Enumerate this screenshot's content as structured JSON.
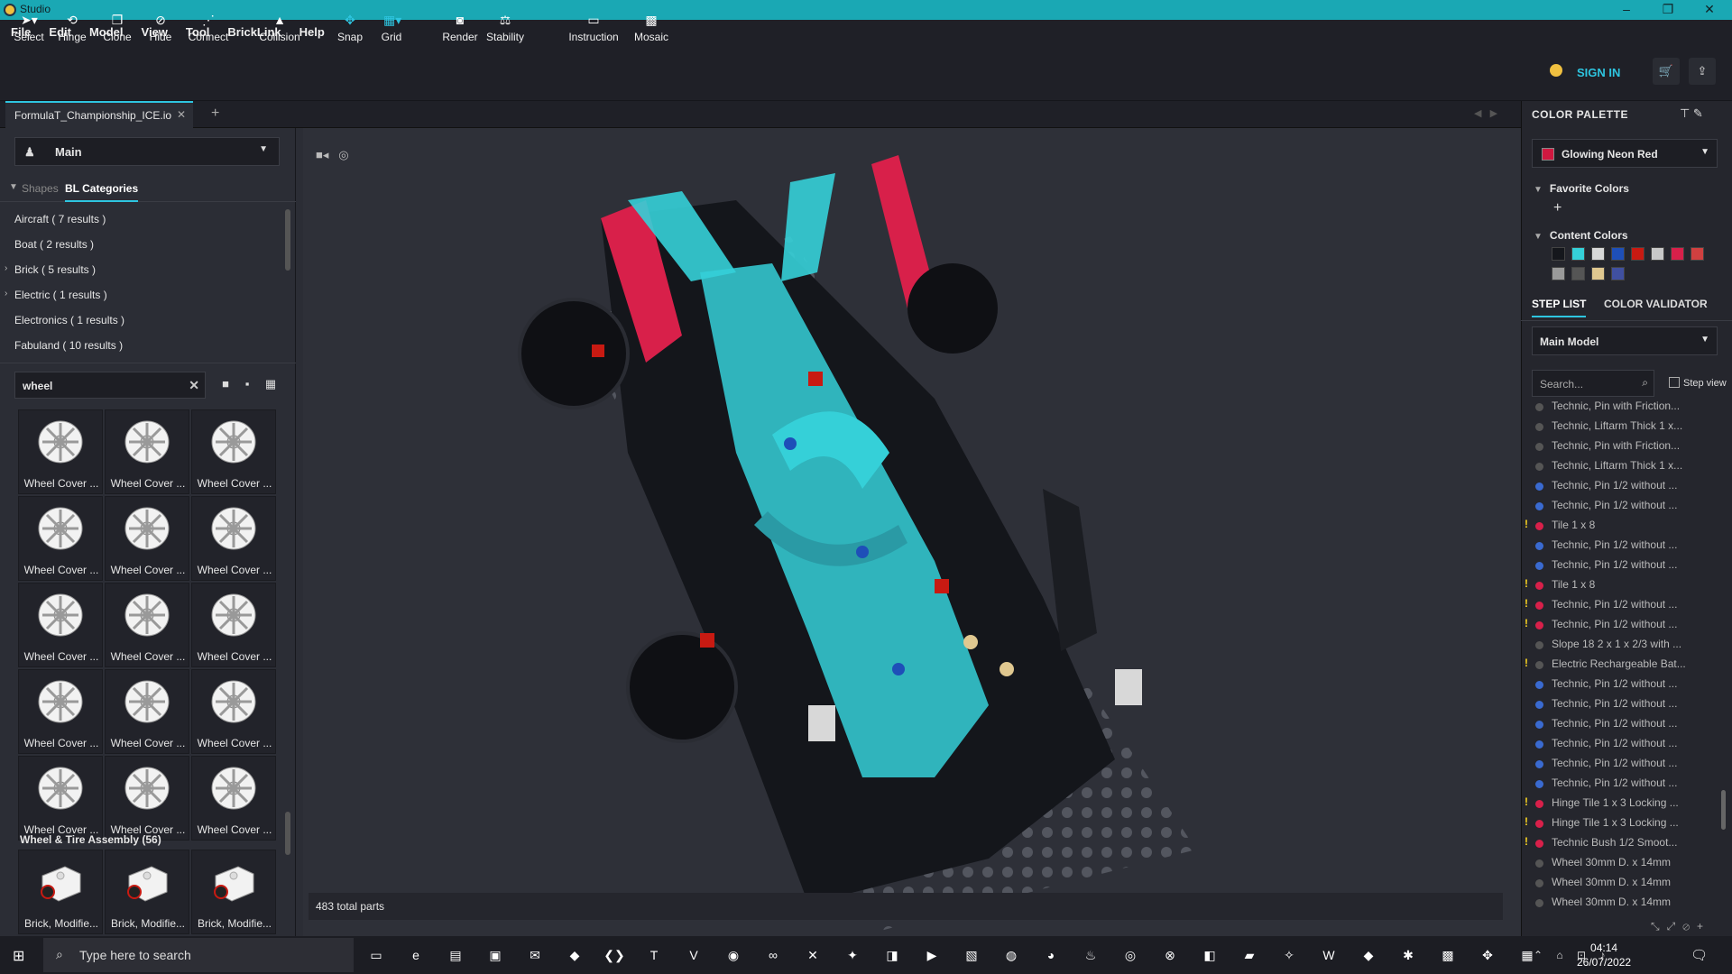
{
  "window": {
    "title": "Studio"
  },
  "menu": [
    "File",
    "Edit",
    "Model",
    "View",
    "Tool",
    "BrickLink",
    "Help"
  ],
  "toolbar": {
    "tools": [
      {
        "label": "Select",
        "icon": "cursor-icon"
      },
      {
        "label": "Hinge",
        "icon": "hinge-icon"
      },
      {
        "label": "Clone",
        "icon": "clone-icon"
      },
      {
        "label": "Hide",
        "icon": "hide-icon"
      },
      {
        "label": "Connect",
        "icon": "connect-icon"
      },
      {
        "label": "Collision",
        "icon": "collision-icon"
      },
      {
        "label": "Snap",
        "icon": "snap-icon"
      },
      {
        "label": "Grid",
        "icon": "grid-icon"
      },
      {
        "label": "Render",
        "icon": "camera-icon"
      },
      {
        "label": "Stability",
        "icon": "stability-icon"
      },
      {
        "label": "Instruction",
        "icon": "instruction-icon"
      },
      {
        "label": "Mosaic",
        "icon": "mosaic-icon"
      }
    ],
    "sign_in": "SIGN IN"
  },
  "tabs": {
    "document": "FormulaT_Championship_ICE.io"
  },
  "left": {
    "model_select": "Main",
    "category_tabs": [
      "Shapes",
      "BL Categories"
    ],
    "categories": [
      {
        "label": "Aircraft ( 7 results )",
        "expandable": false
      },
      {
        "label": "Boat ( 2 results )",
        "expandable": false
      },
      {
        "label": "Brick ( 5 results )",
        "expandable": true
      },
      {
        "label": "Electric ( 1 results )",
        "expandable": true
      },
      {
        "label": "Electronics ( 1 results )",
        "expandable": false
      },
      {
        "label": "Fabuland ( 10 results )",
        "expandable": false
      }
    ],
    "search_value": "wheel",
    "parts": [
      "Wheel Cover ...",
      "Wheel Cover ...",
      "Wheel Cover ...",
      "Wheel Cover ...",
      "Wheel Cover ...",
      "Wheel Cover ...",
      "Wheel Cover ...",
      "Wheel Cover ...",
      "Wheel Cover ...",
      "Wheel Cover ...",
      "Wheel Cover ...",
      "Wheel Cover ...",
      "Wheel Cover ...",
      "Wheel Cover ...",
      "Wheel Cover ..."
    ],
    "section_header": "Wheel & Tire Assembly (56)",
    "assembly_parts": [
      "Brick, Modifie...",
      "Brick, Modifie...",
      "Brick, Modifie..."
    ]
  },
  "viewport": {
    "status": "483 total parts"
  },
  "right": {
    "palette_title": "COLOR PALETTE",
    "selected_color": "Glowing Neon Red",
    "favorite_label": "Favorite Colors",
    "content_label": "Content Colors",
    "content_colors": [
      "#15171c",
      "#35d0d8",
      "#d8d8d8",
      "#1e4fb8",
      "#c81a12",
      "#c8c8c8",
      "#d8204a",
      "#d04040",
      "#9a9a9a",
      "#555555",
      "#e0c890",
      "#4050a0"
    ],
    "step_tabs": [
      "STEP LIST",
      "COLOR VALIDATOR"
    ],
    "model_select": "Main Model",
    "search_placeholder": "Search...",
    "step_view": "Step view",
    "steps": [
      {
        "label": "Technic, Pin with Friction...",
        "color": "#555555",
        "warn": false
      },
      {
        "label": "Technic, Liftarm Thick 1 x...",
        "color": "#555555",
        "warn": false
      },
      {
        "label": "Technic, Pin with Friction...",
        "color": "#555555",
        "warn": false
      },
      {
        "label": "Technic, Liftarm Thick 1 x...",
        "color": "#555555",
        "warn": false
      },
      {
        "label": "Technic, Pin 1/2 without ...",
        "color": "#3a6ad0",
        "warn": false
      },
      {
        "label": "Technic, Pin 1/2 without ...",
        "color": "#3a6ad0",
        "warn": false
      },
      {
        "label": "Tile 1 x 8",
        "color": "#d8204a",
        "warn": true
      },
      {
        "label": "Technic, Pin 1/2 without ...",
        "color": "#3a6ad0",
        "warn": false
      },
      {
        "label": "Technic, Pin 1/2 without ...",
        "color": "#3a6ad0",
        "warn": false
      },
      {
        "label": "Tile 1 x 8",
        "color": "#d8204a",
        "warn": true
      },
      {
        "label": "Technic, Pin 1/2 without ...",
        "color": "#d8204a",
        "warn": true
      },
      {
        "label": "Technic, Pin 1/2 without ...",
        "color": "#d8204a",
        "warn": true
      },
      {
        "label": "Slope 18 2 x 1 x 2/3 with ...",
        "color": "#555555",
        "warn": false
      },
      {
        "label": "Electric Rechargeable Bat...",
        "color": "#555555",
        "warn": true
      },
      {
        "label": "Technic, Pin 1/2 without ...",
        "color": "#3a6ad0",
        "warn": false
      },
      {
        "label": "Technic, Pin 1/2 without ...",
        "color": "#3a6ad0",
        "warn": false
      },
      {
        "label": "Technic, Pin 1/2 without ...",
        "color": "#3a6ad0",
        "warn": false
      },
      {
        "label": "Technic, Pin 1/2 without ...",
        "color": "#3a6ad0",
        "warn": false
      },
      {
        "label": "Technic, Pin 1/2 without ...",
        "color": "#3a6ad0",
        "warn": false
      },
      {
        "label": "Technic, Pin 1/2 without ...",
        "color": "#3a6ad0",
        "warn": false
      },
      {
        "label": "Hinge Tile 1 x 3 Locking ...",
        "color": "#d8204a",
        "warn": true
      },
      {
        "label": "Hinge Tile 1 x 3 Locking ...",
        "color": "#d8204a",
        "warn": true
      },
      {
        "label": "Technic Bush 1/2 Smoot...",
        "color": "#d8204a",
        "warn": true
      },
      {
        "label": "Wheel 30mm D. x 14mm",
        "color": "#555555",
        "warn": false
      },
      {
        "label": "Wheel 30mm D. x 14mm",
        "color": "#555555",
        "warn": false
      },
      {
        "label": "Wheel 30mm D. x 14mm",
        "color": "#555555",
        "warn": false
      }
    ]
  },
  "taskbar": {
    "search_placeholder": "Type here to search",
    "time": "04:14",
    "date": "26/07/2022"
  }
}
